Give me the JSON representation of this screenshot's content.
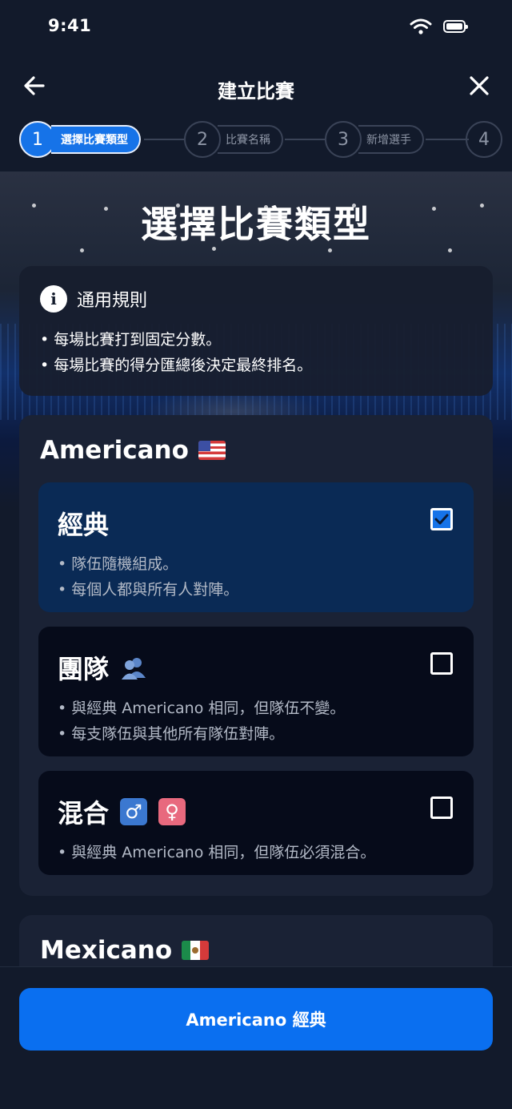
{
  "status_bar": {
    "time": "9:41"
  },
  "nav": {
    "title": "建立比賽"
  },
  "stepper": [
    {
      "number": "1",
      "label": "選擇比賽類型",
      "active": true
    },
    {
      "number": "2",
      "label": "比賽名稱",
      "active": false
    },
    {
      "number": "3",
      "label": "新增選手",
      "active": false
    },
    {
      "number": "4",
      "label": "",
      "active": false
    }
  ],
  "page": {
    "title": "選擇比賽類型"
  },
  "rules": {
    "title": "通用規則",
    "items": [
      "每場比賽打到固定分數。",
      "每場比賽的得分匯總後決定最終排名。"
    ]
  },
  "groups": [
    {
      "title": "Americano",
      "flag": "us-flag",
      "options": [
        {
          "title": "經典",
          "icons": [],
          "checked": true,
          "desc": [
            "隊伍隨機組成。",
            "每個人都與所有人對陣。"
          ]
        },
        {
          "title": "團隊",
          "icons": [
            "team-silhouette-icon"
          ],
          "checked": false,
          "desc": [
            "與經典 Americano 相同，但隊伍不變。",
            "每支隊伍與其他所有隊伍對陣。"
          ]
        },
        {
          "title": "混合",
          "icons": [
            "male-sign-icon",
            "female-sign-icon"
          ],
          "checked": false,
          "desc": [
            "與經典 Americano 相同，但隊伍必須混合。"
          ]
        }
      ]
    },
    {
      "title": "Mexicano",
      "flag": "mexico-flag"
    }
  ],
  "footer": {
    "button_label": "Americano 經典"
  },
  "colors": {
    "accent": "#1673e8",
    "background": "#121a2b",
    "card": "#1a2235",
    "selected": "#0a2a55"
  },
  "icons": {
    "male_symbol": "♂",
    "female_symbol": "♀",
    "info_symbol": "i"
  }
}
